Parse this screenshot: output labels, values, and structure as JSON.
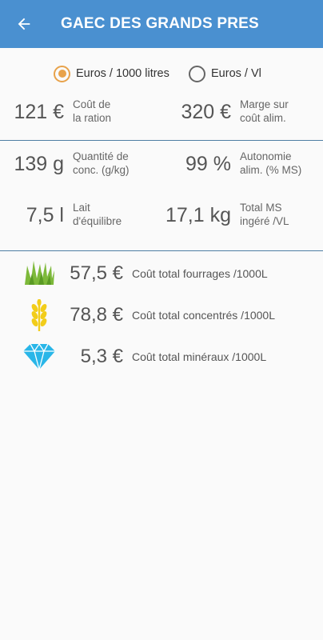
{
  "appbar": {
    "title": "GAEC DES GRANDS PRES",
    "back_icon": "arrow-left-icon"
  },
  "unit_toggle": {
    "options": [
      "Euros / 1000 litres",
      "Euros / Vl"
    ],
    "selected": "Euros / 1000 litres",
    "selected_color": "#e8a24a"
  },
  "metrics": {
    "cout_ration": {
      "value": "121 €",
      "label_1": "Coût de",
      "label_2": "la ration"
    },
    "marge": {
      "value": "320 €",
      "label_1": "Marge sur",
      "label_2": "coût alim."
    },
    "quantite_conc": {
      "value": "139 g",
      "label_1": "Quantité de",
      "label_2": "conc. (g/kg)"
    },
    "autonomie": {
      "value": "99 %",
      "label_1": "Autonomie",
      "label_2": "alim. (% MS)"
    },
    "lait_equilibre": {
      "value": "7,5 l",
      "label_1": "Lait",
      "label_2": "d'équilibre"
    },
    "total_ms": {
      "value": "17,1 kg",
      "label_1": "Total MS",
      "label_2": "ingéré /VL"
    }
  },
  "costs": [
    {
      "icon": "grass-icon",
      "value": "57,5 €",
      "label": "Coût total fourrages /1000L"
    },
    {
      "icon": "wheat-icon",
      "value": "78,8 €",
      "label": "Coût total concentrés /1000L"
    },
    {
      "icon": "diamond-icon",
      "value": "5,3 €",
      "label": "Coût total minéraux /1000L"
    }
  ],
  "colors": {
    "appbar": "#4a90d0",
    "divider": "#4f7fa3",
    "grass": "#7db93a",
    "wheat": "#f2cd1a",
    "diamond": "#29b6e8"
  }
}
